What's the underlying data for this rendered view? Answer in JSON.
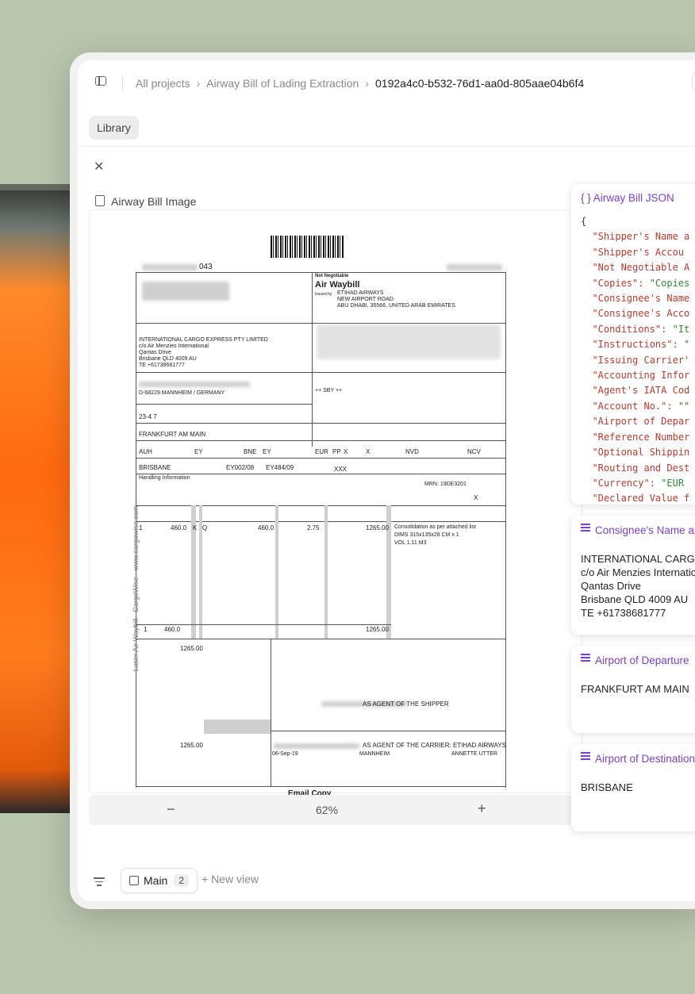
{
  "breadcrumb": {
    "items": [
      "All projects",
      "Airway Bill of Lading Extraction",
      "0192a4c0-b532-76d1-aa0d-805aae04b6f4"
    ]
  },
  "toolbar": {
    "library_label": "Library"
  },
  "left_panel": {
    "title": "Airway Bill Image",
    "zoom": {
      "minus": "−",
      "value": "62%",
      "plus": "+"
    }
  },
  "waybill": {
    "not_negotiable": "Not Negotiable",
    "air_waybill": "Air Waybill",
    "issued_by": "Issued by",
    "carrier": "ETIHAD AIRWAYS",
    "carrier_addr1": "NEW AIRPORT ROAD",
    "carrier_addr2": "ABU DHABI, 35566, UNITED ARAB EMIRATES",
    "awb_suffix": "043",
    "consignee_1": "INTERNATIONAL CARGO EXPRESS PTY LIMITED",
    "consignee_2": "c/o Air Menzies International",
    "consignee_3": "Qantas Drive",
    "consignee_4": "Brisbane QLD 4009 AU",
    "consignee_5": "TE +61738681777",
    "agent_city": "D-68229 MANNHEIM / GERMANY",
    "accounting": "++ SBY ++",
    "iata_code": "23-4 7",
    "departure": "FRANKFURT AM MAIN",
    "to1": "AUH",
    "carrier_code": "EY",
    "to2": "BNE",
    "by2": "EY",
    "currency": "EUR",
    "ppd": "PP",
    "x1": "X",
    "x2": "X",
    "dvc": "NVD",
    "dvcustoms": "NCV",
    "destination": "BRISBANE",
    "flight1": "EY002/08",
    "flight2": "EY484/09",
    "insurance": "XXX",
    "handling": "Handling Information",
    "mrn": "MRN: 19DE3201",
    "sci_x": "X",
    "pieces": "1",
    "weight": "460.0",
    "unit": "K",
    "rate_class": "Q",
    "chargeable": "460.0",
    "rate": "2.75",
    "total": "1265.00",
    "goods1": "Consolidation as per attached list",
    "goods2": "DIMS 315x135x28 CM x 1",
    "goods3": "VOL 1.11 M3",
    "total_pieces": "1",
    "total_weight": "460.0",
    "total_charge": "1265.00",
    "prepaid": "1265.00",
    "total_prepaid": "1265.00",
    "agent_of_shipper": "AS AGENT OF THE SHIPPER",
    "agent_of_carrier": "AS AGENT OF THE CARRIER: ETIHAD AIRWAYS",
    "exec_date": "06-Sep-19",
    "exec_place": "MANNHEIM",
    "signatory": "ANNETTE UTTER",
    "email_copy": "Email Copy",
    "side_text": "Laser Air Waybill - CargoWise - www.cargowise.com"
  },
  "json_panel": {
    "title": "Airway Bill JSON",
    "open_brace": "{",
    "lines": [
      {
        "k": "\"Shipper's Name a",
        "v": ""
      },
      {
        "k": "\"Shipper's Accou",
        "v": ""
      },
      {
        "k": "\"Not Negotiable A",
        "v": ""
      },
      {
        "k": "\"Copies\": ",
        "v": "\"Copies"
      },
      {
        "k": "\"Consignee's Name",
        "v": ""
      },
      {
        "k": "\"Consignee's Acco",
        "v": ""
      },
      {
        "k": "\"Conditions\": ",
        "v": "\"It"
      },
      {
        "k": "\"Instructions\": ",
        "v": "\""
      },
      {
        "k": "\"Issuing Carrier'",
        "v": ""
      },
      {
        "k": "\"Accounting Infor",
        "v": ""
      },
      {
        "k": "\"Agent's IATA Cod",
        "v": ""
      },
      {
        "k": "\"Account No.\": ",
        "v": "\"\""
      },
      {
        "k": "\"Airport of Depar",
        "v": ""
      },
      {
        "k": "\"Reference Number",
        "v": ""
      },
      {
        "k": "\"Optional Shippin",
        "v": ""
      },
      {
        "k": "\"Routing and Dest",
        "v": ""
      },
      {
        "k": "\"Currency\": ",
        "v": "\"EUR"
      },
      {
        "k": "\"Declared Value f",
        "v": ""
      }
    ]
  },
  "cards": {
    "consignee": {
      "title": "Consignee's Name and Address",
      "lines": [
        "INTERNATIONAL CARGO EXPRESS PTY LIMITED",
        "c/o Air Menzies International",
        "Qantas Drive",
        "Brisbane QLD 4009 AU",
        "TE +61738681777"
      ]
    },
    "departure": {
      "title": "Airport of Departure",
      "value": "FRANKFURT AM MAIN"
    },
    "destination": {
      "title": "Airport of Destination",
      "value": "BRISBANE"
    }
  },
  "bottombar": {
    "main_tab_label": "Main",
    "main_tab_count": "2",
    "new_view_label": "+ New view"
  }
}
